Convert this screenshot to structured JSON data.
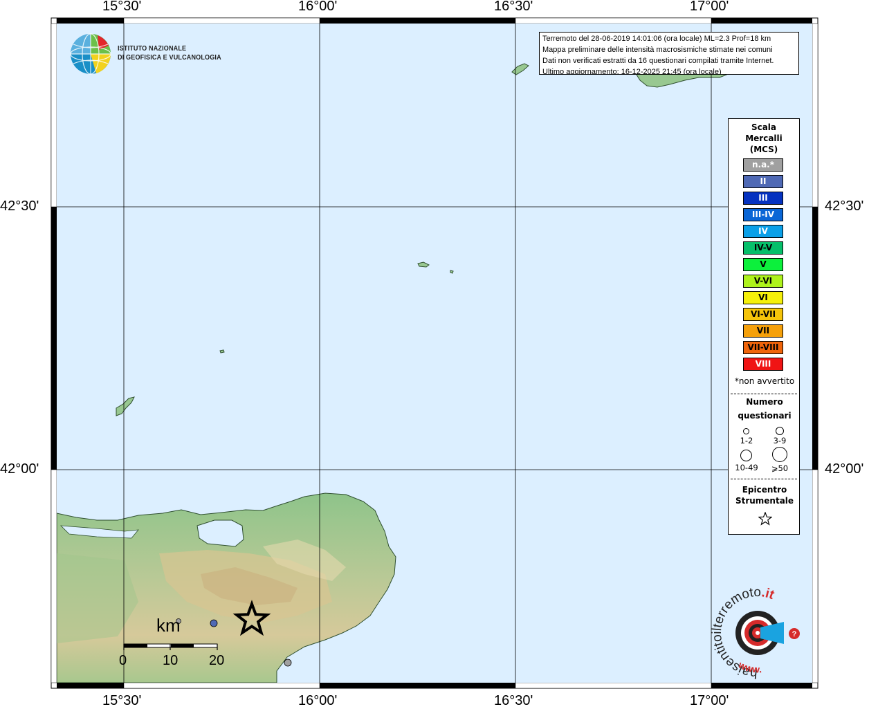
{
  "map": {
    "lon_labels": [
      "15°30'",
      "16°00'",
      "16°30'",
      "17°00'"
    ],
    "lat_labels": [
      "42°30'",
      "42°00'"
    ]
  },
  "info": {
    "line1": "Terremoto del 28-06-2019 14:01:06 (ora locale) ML=2.3 Prof=18 km",
    "line2": "Mappa preliminare delle intensità macrosismiche stimate nei comuni",
    "line3": "Dati non verificati estratti da 16 questionari compilati tramite Internet.",
    "line4": "Ultimo aggiornamento: 16-12-2025 21:45 (ora locale)"
  },
  "institute": {
    "line1": "ISTITUTO NAZIONALE",
    "line2": "DI GEOFISICA E VULCANOLOGIA"
  },
  "legend": {
    "title1": "Scala",
    "title2": "Mercalli",
    "title3": "(MCS)",
    "classes": [
      {
        "label": "n.a.*",
        "color": "#a0a0a0",
        "text": "#ffffff"
      },
      {
        "label": "II",
        "color": "#4f69b5",
        "text": "#ffffff"
      },
      {
        "label": "III",
        "color": "#0532c0",
        "text": "#ffffff"
      },
      {
        "label": "III-IV",
        "color": "#0a66d6",
        "text": "#ffffff"
      },
      {
        "label": "IV",
        "color": "#0aa0e8",
        "text": "#ffffff"
      },
      {
        "label": "IV-V",
        "color": "#06bf6a",
        "text": "#000000"
      },
      {
        "label": "V",
        "color": "#0cf03c",
        "text": "#000000"
      },
      {
        "label": "V-VI",
        "color": "#aef21c",
        "text": "#000000"
      },
      {
        "label": "VI",
        "color": "#f5f00a",
        "text": "#000000"
      },
      {
        "label": "VI-VII",
        "color": "#f5c40a",
        "text": "#000000"
      },
      {
        "label": "VII",
        "color": "#f5a00a",
        "text": "#000000"
      },
      {
        "label": "VII-VIII",
        "color": "#f0640a",
        "text": "#000000"
      },
      {
        "label": "VIII",
        "color": "#f01414",
        "text": "#ffffff"
      }
    ],
    "not_felt_note": "*non avvertito",
    "count_title1": "Numero",
    "count_title2": "questionari",
    "counts": [
      "1-2",
      "3-9",
      "10-49",
      "⩾50"
    ],
    "epicenter_title1": "Epicentro",
    "epicenter_title2": "Strumentale"
  },
  "scale_bar": {
    "unit": "km",
    "ticks": [
      "0",
      "10",
      "20"
    ]
  },
  "hsit": {
    "text_main": "haisentitoilterremoto",
    "text_tld": ".it",
    "text_www": "www."
  },
  "colors": {
    "sea": "#dcefff",
    "epicenter_star": "#000000",
    "point_intensity_II": "#4f69b5",
    "point_na": "#a0a0a0"
  }
}
